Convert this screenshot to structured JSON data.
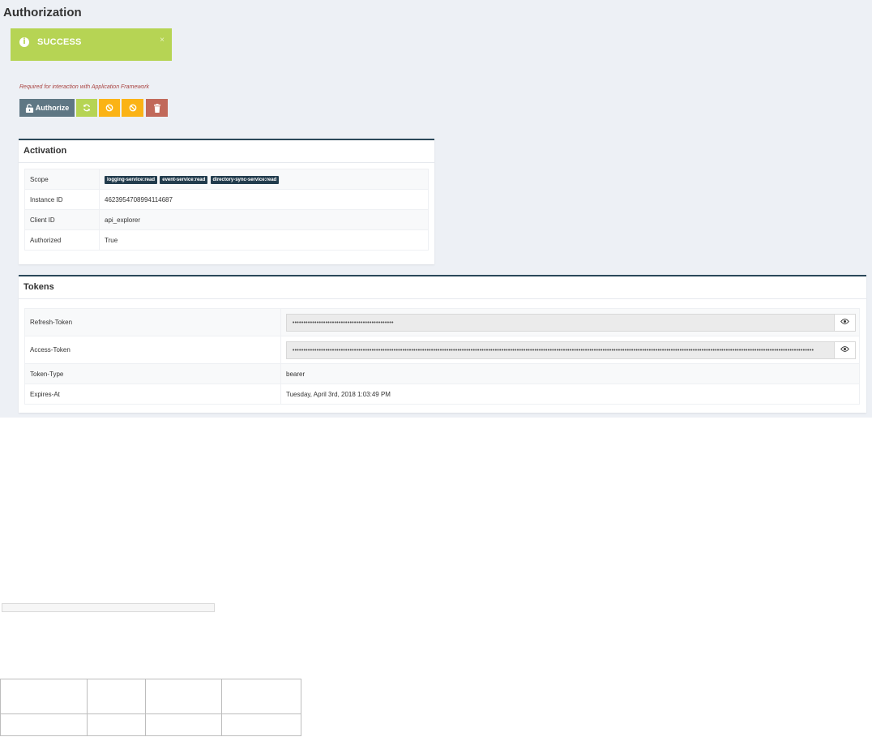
{
  "page": {
    "title": "Authorization"
  },
  "alert": {
    "message": "SUCCESS",
    "close_label": "×"
  },
  "hint": "Required for interaction with Application Framework",
  "toolbar": {
    "authorize_label": "Authorize"
  },
  "activation": {
    "title": "Activation",
    "scope_label": "Scope",
    "scopes": [
      "logging-service:read",
      "event-service:read",
      "directory-sync-service:read"
    ],
    "instance_id_label": "Instance ID",
    "instance_id": "4623954708994114687",
    "client_id_label": "Client ID",
    "client_id": "api_explorer",
    "authorized_label": "Authorized",
    "authorized": "True"
  },
  "tokens": {
    "title": "Tokens",
    "refresh_label": "Refresh-Token",
    "refresh_value": "••••••••••••••••••••••••••••••••••••••••••••••",
    "access_label": "Access-Token",
    "access_value": "•••••••••••••••••••••••••••••••••••••••••••••••••••••••••••••••••••••••••••••••••••••••••••••••••••••••••••••••••••••••••••••••••••••••••••••••••••••••••••••••••••••••••••••••••••••••••••••••••••••••••••••••••••••••••••••••••••••••••••••",
    "type_label": "Token-Type",
    "type_value": "bearer",
    "expires_label": "Expires-At",
    "expires_value": "Tuesday, April 3rd, 2018 1:03:49 PM"
  },
  "colors": {
    "success": "#b6d454",
    "warning": "#fbb315",
    "danger": "#c1695a",
    "primary": "#5f7784",
    "panel_border": "#2b4859"
  },
  "icons": {
    "alert": "info-circle-icon",
    "authorize": "unlock-icon",
    "refresh": "refresh-icon",
    "revoke": "ban-icon",
    "delete": "trash-icon",
    "reveal": "eye-icon"
  }
}
